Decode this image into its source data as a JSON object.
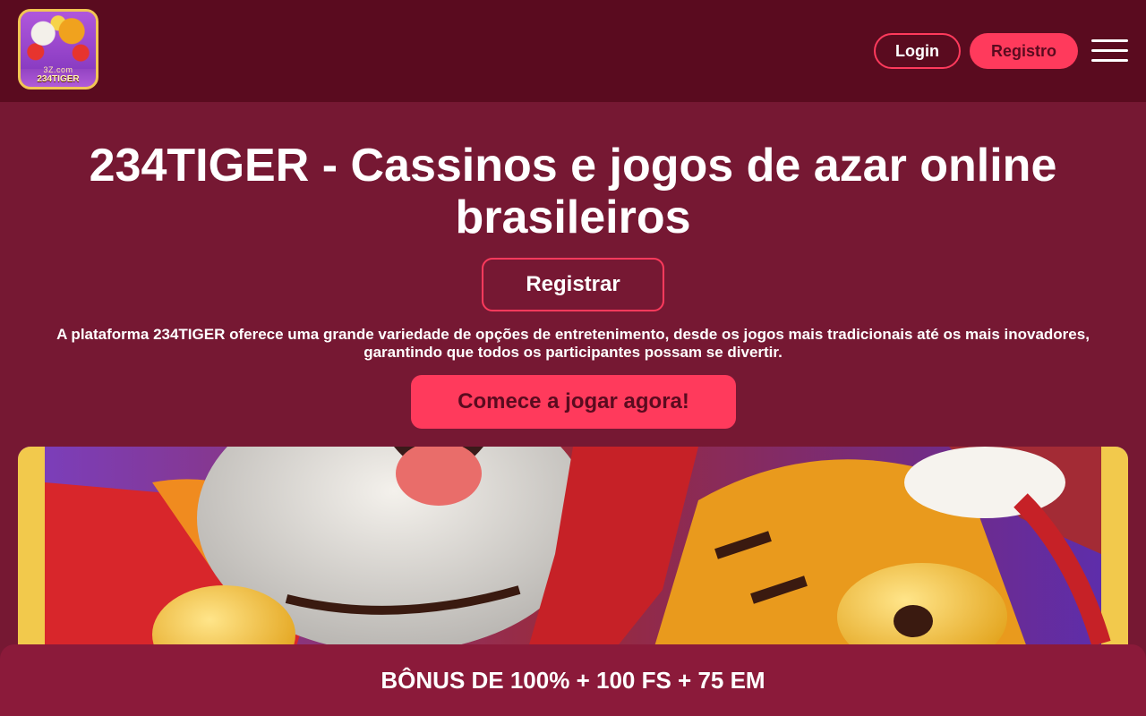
{
  "header": {
    "logo": {
      "subtext": "3Z.com",
      "brand": "234TIGER"
    },
    "login_label": "Login",
    "register_label": "Registro",
    "menu_icon": "hamburger-menu-icon"
  },
  "hero": {
    "title": "234TIGER - Cassinos e jogos de azar online brasileiros",
    "register_button": "Registrar",
    "description": "A plataforma 234TIGER oferece uma grande variedade de opções de entretenimento, desde os jogos mais tradicionais até os mais inovadores, garantindo que todos os participantes possam se divertir.",
    "play_button": "Comece a jogar agora!"
  },
  "banner": {
    "image": "fortune-tiger-rabbit-banner"
  },
  "bonus_bar": {
    "text": "BÔNUS DE 100% + 100 FS + 75 EM"
  },
  "colors": {
    "background": "#761833",
    "header": "#5a0b1f",
    "accent": "#ff3a5c",
    "bonus_bar": "#8b1a3a"
  }
}
